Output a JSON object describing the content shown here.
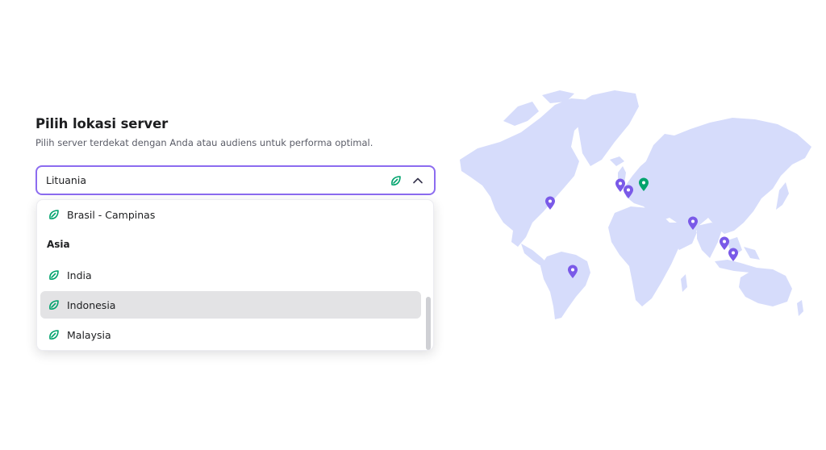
{
  "header": {
    "title": "Pilih lokasi server",
    "subtitle": "Pilih server terdekat dengan Anda atau audiens untuk performa optimal."
  },
  "select": {
    "value": "Lituania",
    "state": "open"
  },
  "dropdown": {
    "items": [
      {
        "type": "option",
        "label": "Brasil - Campinas",
        "icon": "leaf-icon"
      },
      {
        "type": "group",
        "label": "Asia"
      },
      {
        "type": "option",
        "label": "India",
        "icon": "leaf-icon"
      },
      {
        "type": "option",
        "label": "Indonesia",
        "icon": "leaf-icon",
        "highlighted": true
      },
      {
        "type": "option",
        "label": "Malaysia",
        "icon": "leaf-icon"
      }
    ]
  },
  "colors": {
    "accent": "#8c6cf0",
    "leaf": "#00a36d",
    "pin_default": "#7a5ae8",
    "pin_active": "#00a36d",
    "map_land": "#d6dcfb",
    "highlight_row": "#e3e3e5"
  },
  "map": {
    "pins": [
      {
        "location": "USA",
        "active": false
      },
      {
        "location": "United Kingdom",
        "active": false
      },
      {
        "location": "France",
        "active": false
      },
      {
        "location": "Lithuania",
        "active": true
      },
      {
        "location": "India",
        "active": false
      },
      {
        "location": "Malaysia",
        "active": false
      },
      {
        "location": "Indonesia",
        "active": false
      },
      {
        "location": "Brazil",
        "active": false
      }
    ]
  }
}
